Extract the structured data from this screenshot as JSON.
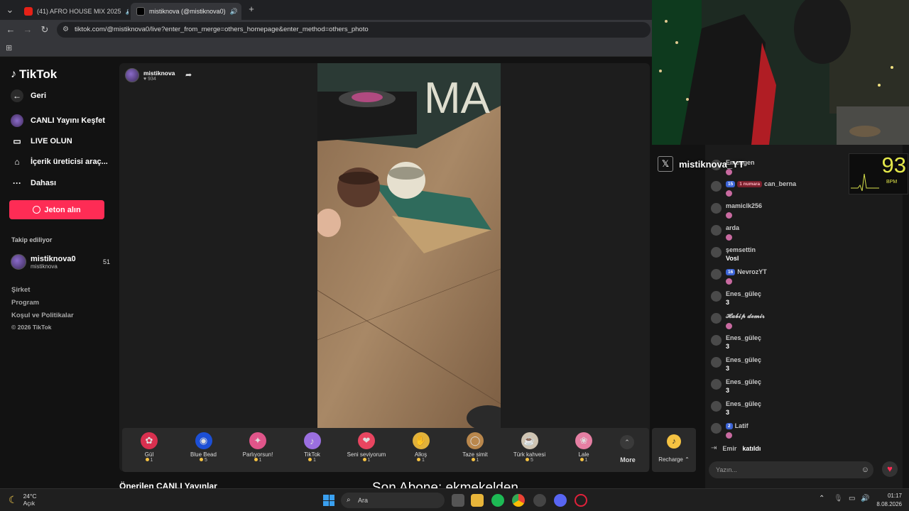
{
  "browser": {
    "tabs": [
      {
        "title": "(41) AFRO HOUSE MIX 2025",
        "active": false
      },
      {
        "title": "mistiknova (@mistiknova0)",
        "active": true
      }
    ],
    "url": "tiktok.com/@mistiknova0/live?enter_from_merge=others_homepage&enter_method=others_photo"
  },
  "sidebar": {
    "logo": "TikTok",
    "back": "Geri",
    "nav": [
      {
        "label": "CANLI Yayını Keşfet",
        "icon": "live-explore-icon"
      },
      {
        "label": "LIVE OLUN",
        "icon": "camera-icon"
      },
      {
        "label": "İçerik üreticisi araç...",
        "icon": "creator-tools-icon"
      },
      {
        "label": "Dahası",
        "icon": "more-dots-icon"
      }
    ],
    "jeton_button": "Jeton alın",
    "following_heading": "Takip ediliyor",
    "following": {
      "name": "mistiknova0",
      "handle": "mistiknova",
      "count": "51"
    },
    "footer": [
      "Şirket",
      "Program",
      "Koşul ve Politikalar",
      "© 2026 TikTok"
    ]
  },
  "stream": {
    "host_name": "mistiknova",
    "likes": "934",
    "recommended_heading": "Önerilen CANLI Yayınlar"
  },
  "gifts": [
    {
      "name": "Gül",
      "price": "1",
      "color": "#d9304f",
      "icon": "rose-icon"
    },
    {
      "name": "Blue Bead",
      "price": "5",
      "color": "#1c4fd6",
      "icon": "blue-bead-icon"
    },
    {
      "name": "Parlıyorsun!",
      "price": "1",
      "color": "#e0558a",
      "icon": "shine-icon"
    },
    {
      "name": "TikTok",
      "price": "1",
      "color": "#9b6fe0",
      "icon": "tiktok-gift-icon"
    },
    {
      "name": "Seni seviyorum",
      "price": "1",
      "color": "#e84560",
      "icon": "love-icon"
    },
    {
      "name": "Alkış",
      "price": "1",
      "color": "#e2b23a",
      "icon": "clap-icon"
    },
    {
      "name": "Taze simit",
      "price": "1",
      "color": "#b9874c",
      "icon": "simit-icon"
    },
    {
      "name": "Türk kahvesi",
      "price": "5",
      "color": "#cfc4b2",
      "icon": "coffee-icon"
    },
    {
      "name": "Lale",
      "price": "1",
      "color": "#e57fa3",
      "icon": "tulip-icon"
    }
  ],
  "gift_more": "More",
  "recharge": "Recharge",
  "overlay": {
    "x_name": "mistiknova_YT",
    "bpm_value": "93",
    "bpm_label": "BPM",
    "subtitle": "Son Abone: ekmekelden"
  },
  "chat": {
    "messages": [
      {
        "user": "Emengen",
        "badges": [],
        "text": ""
      },
      {
        "user": "can_berna",
        "badges": [
          "15",
          "1 numara"
        ],
        "text": ""
      },
      {
        "user": "mamiclk256",
        "badges": [],
        "text": ""
      },
      {
        "user": "arda",
        "badges": [],
        "text": ""
      },
      {
        "user": "şemsettin",
        "badges": [],
        "text": "Vosl"
      },
      {
        "user": "NevrozYT",
        "badges": [
          "16"
        ],
        "text": ""
      },
      {
        "user": "Enes_güleç",
        "badges": [],
        "text": "3"
      },
      {
        "user": "𝓗𝓪𝓫𝓲𝓹 𝓭𝓮𝓶𝓲𝓻",
        "badges": [],
        "text": ""
      },
      {
        "user": "Enes_güleç",
        "badges": [],
        "text": "3"
      },
      {
        "user": "Enes_güleç",
        "badges": [],
        "text": "3"
      },
      {
        "user": "Enes_güleç",
        "badges": [],
        "text": "3"
      },
      {
        "user": "Enes_güleç",
        "badges": [],
        "text": "3"
      },
      {
        "user": "Latif",
        "badges": [
          "2"
        ],
        "text": ""
      }
    ],
    "join_user": "Emir",
    "join_text": "katıldı",
    "input_placeholder": "Yazın..."
  },
  "taskbar": {
    "temperature": "24°C",
    "weather_status": "Açık",
    "search_placeholder": "Ara",
    "time": "01:17",
    "date": "8.08.2026"
  }
}
